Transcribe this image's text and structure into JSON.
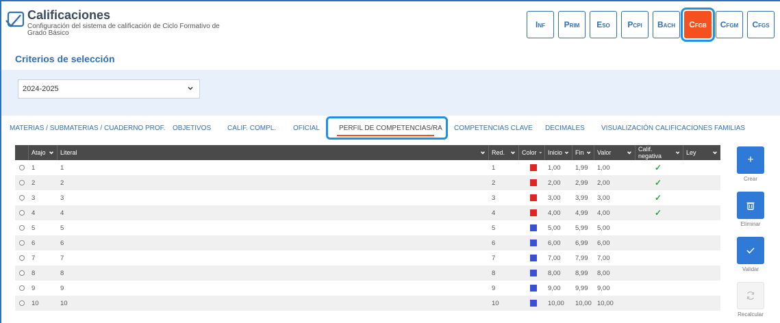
{
  "header": {
    "title": "Calificaciones",
    "subtitle": "Configuración del sistema de calificación de Ciclo Formativo de Grado Básico"
  },
  "levels": [
    {
      "label": "Inf",
      "active": false
    },
    {
      "label": "Prim",
      "active": false
    },
    {
      "label": "Eso",
      "active": false
    },
    {
      "label": "Pcpi",
      "active": false
    },
    {
      "label": "Bach",
      "active": false
    },
    {
      "label": "Cfgb",
      "active": true
    },
    {
      "label": "Cfgm",
      "active": false
    },
    {
      "label": "Cfgs",
      "active": false
    }
  ],
  "section": {
    "title": "Criterios de selección"
  },
  "filter": {
    "year": "2024-2025"
  },
  "tabs": [
    {
      "label": "MATERIAS / SUBMATERIAS / CUADERNO PROF."
    },
    {
      "label": "OBJETIVOS"
    },
    {
      "label": "CALIF. COMPL."
    },
    {
      "label": "OFICIAL"
    },
    {
      "label": "PERFIL DE COMPETENCIAS/RA"
    },
    {
      "label": "COMPETENCIAS CLAVE"
    },
    {
      "label": "DECIMALES"
    },
    {
      "label": "VISUALIZACIÓN CALIFICACIONES FAMILIAS"
    }
  ],
  "table": {
    "columns": {
      "atajo": "Atajo",
      "literal": "Literal",
      "red": "Red.",
      "color": "Color",
      "inicio": "Inicio",
      "fin": "Fin",
      "valor": "Valor",
      "calif_negativa": "Calif. negativa",
      "ley": "Ley"
    },
    "rows": [
      {
        "atajo": "1",
        "literal": "1",
        "red": "1",
        "color": "#e02424",
        "inicio": "1,00",
        "fin": "1,99",
        "valor": "1,00",
        "negativa": true
      },
      {
        "atajo": "2",
        "literal": "2",
        "red": "2",
        "color": "#e02424",
        "inicio": "2,00",
        "fin": "2,99",
        "valor": "2,00",
        "negativa": true
      },
      {
        "atajo": "3",
        "literal": "3",
        "red": "3",
        "color": "#e02424",
        "inicio": "3,00",
        "fin": "3,99",
        "valor": "3,00",
        "negativa": true
      },
      {
        "atajo": "4",
        "literal": "4",
        "red": "4",
        "color": "#e02424",
        "inicio": "4,00",
        "fin": "4,99",
        "valor": "4,00",
        "negativa": true
      },
      {
        "atajo": "5",
        "literal": "5",
        "red": "5",
        "color": "#3a4fd6",
        "inicio": "5,00",
        "fin": "5,99",
        "valor": "5,00",
        "negativa": false
      },
      {
        "atajo": "6",
        "literal": "6",
        "red": "6",
        "color": "#3a4fd6",
        "inicio": "6,00",
        "fin": "6,99",
        "valor": "6,00",
        "negativa": false
      },
      {
        "atajo": "7",
        "literal": "7",
        "red": "7",
        "color": "#3a4fd6",
        "inicio": "7,00",
        "fin": "7,99",
        "valor": "7,00",
        "negativa": false
      },
      {
        "atajo": "8",
        "literal": "8",
        "red": "8",
        "color": "#3a4fd6",
        "inicio": "8,00",
        "fin": "8,99",
        "valor": "8,00",
        "negativa": false
      },
      {
        "atajo": "9",
        "literal": "9",
        "red": "9",
        "color": "#3a4fd6",
        "inicio": "9,00",
        "fin": "9,99",
        "valor": "9,00",
        "negativa": false
      },
      {
        "atajo": "10",
        "literal": "10",
        "red": "10",
        "color": "#3a4fd6",
        "inicio": "10,00",
        "fin": "10,00",
        "valor": "10,00",
        "negativa": false
      }
    ]
  },
  "actions": {
    "crear": "Crear",
    "eliminar": "Eliminar",
    "validar": "Validar",
    "recalcular": "Recalcular"
  },
  "colors": {
    "accent": "#2f6fb7",
    "active_level": "#f4511e",
    "highlight": "#1e90e6",
    "check": "#2ea043"
  }
}
